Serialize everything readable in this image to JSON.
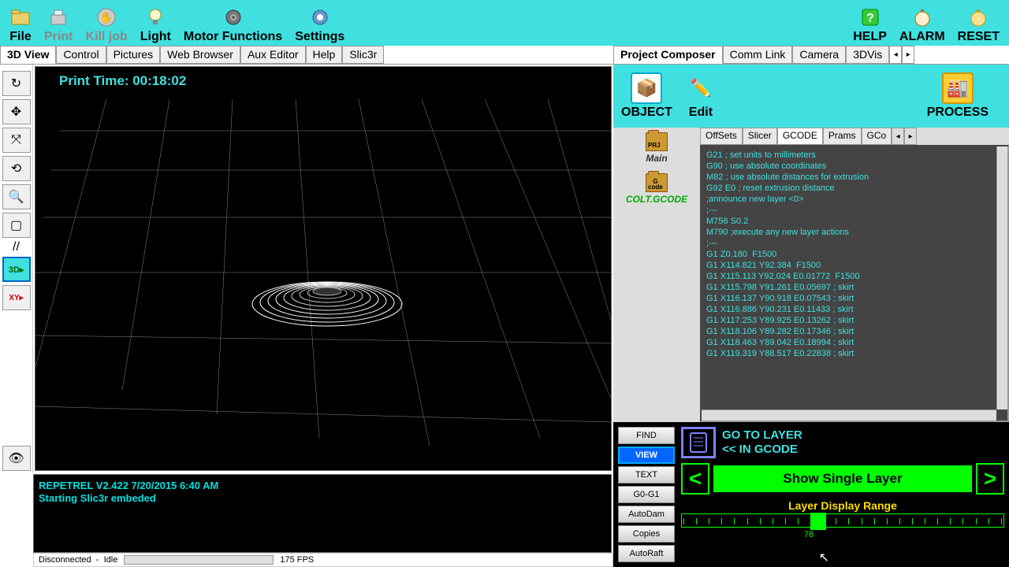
{
  "toolbar": {
    "file": "File",
    "print": "Print",
    "kill_job": "Kill job",
    "light": "Light",
    "motor_functions": "Motor Functions",
    "settings": "Settings",
    "help": "HELP",
    "alarm": "ALARM",
    "reset": "RESET"
  },
  "left_tabs": [
    "3D View",
    "Control",
    "Pictures",
    "Web Browser",
    "Aux Editor",
    "Help",
    "Slic3r"
  ],
  "left_active_tab": "3D View",
  "right_tabs": [
    "Project Composer",
    "Comm Link",
    "Camera",
    "3DVis"
  ],
  "right_active_tab": "Project Composer",
  "viewer": {
    "print_time_label": "Print Time:",
    "print_time_value": "00:18:02"
  },
  "console": {
    "line1": "REPETREL V2.422 7/20/2015 6:40 AM",
    "line2": "Starting Slic3r embeded"
  },
  "status": {
    "connection": "Disconnected",
    "sep": "-",
    "state": "Idle",
    "fps_label": "175 FPS"
  },
  "composer": {
    "object": "OBJECT",
    "edit": "Edit",
    "process": "PROCESS"
  },
  "tree": {
    "main": "Main",
    "main_badge": "PRJ",
    "gcode_file": "COLT.GCODE",
    "gcode_badge": "G\ncode"
  },
  "sub_tabs": [
    "OffSets",
    "Slicer",
    "GCODE",
    "Prams",
    "GCo"
  ],
  "sub_active": "GCODE",
  "gcode_lines": [
    "G21 ; set units to millimeters",
    "G90 ; use absolute coordinates",
    "M82 ; use absolute distances for extrusion",
    "G92 E0 ; reset extrusion distance",
    ";announce new layer <0>",
    ";---",
    "M756 S0.2",
    "M790 ;execute any new layer actions",
    ";---",
    "G1 Z0.180  F1500",
    "G1 X114.821 Y92.384  F1500",
    "G1 X115.113 Y92.024 E0.01772  F1500",
    "G1 X115.798 Y91.261 E0.05697 ; skirt",
    "G1 X116.137 Y90.918 E0.07543 ; skirt",
    "G1 X116.886 Y90.231 E0.11433 ; skirt",
    "G1 X117.253 Y89.925 E0.13262 ; skirt",
    "G1 X118.106 Y89.282 E0.17346 ; skirt",
    "G1 X118.463 Y89.042 E0.18994 ; skirt",
    "G1 X119.319 Y88.517 E0.22838 ; skirt"
  ],
  "layer_buttons": [
    "FIND",
    "VIEW",
    "TEXT",
    "G0-G1",
    "AutoDam",
    "Copies",
    "AutoRaft"
  ],
  "layer_active_button": "VIEW",
  "layer": {
    "goto_line1": "GO TO LAYER",
    "goto_line2": "<< IN GCODE",
    "single": "Show Single Layer",
    "range_label": "Layer Display Range",
    "range_value": "76"
  }
}
